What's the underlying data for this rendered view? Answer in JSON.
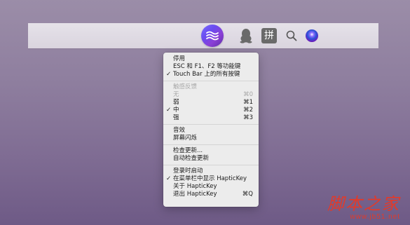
{
  "menubar": {
    "icons": [
      "haptickey-icon",
      "qq-penguin-icon",
      "pinyin-input-icon",
      "spotlight-search-icon",
      "siri-icon"
    ],
    "pinyin_label": "拼"
  },
  "menu": {
    "items": [
      {
        "label": "停用",
        "checked": false,
        "disabled": false,
        "shortcut": ""
      },
      {
        "label": "ESC 和 F1、F2 等功能键",
        "checked": false,
        "disabled": false,
        "shortcut": ""
      },
      {
        "label": "Touch Bar 上的所有按键",
        "checked": true,
        "disabled": false,
        "shortcut": ""
      },
      {
        "label": "触感反馈",
        "checked": false,
        "disabled": true,
        "shortcut": ""
      },
      {
        "label": "无",
        "checked": false,
        "disabled": true,
        "shortcut": "⌘0"
      },
      {
        "label": "弱",
        "checked": false,
        "disabled": false,
        "shortcut": "⌘1"
      },
      {
        "label": "中",
        "checked": true,
        "disabled": false,
        "shortcut": "⌘2"
      },
      {
        "label": "强",
        "checked": false,
        "disabled": false,
        "shortcut": "⌘3"
      },
      {
        "label": "音效",
        "checked": false,
        "disabled": false,
        "shortcut": ""
      },
      {
        "label": "屏幕闪烁",
        "checked": false,
        "disabled": false,
        "shortcut": ""
      },
      {
        "label": "检查更新...",
        "checked": false,
        "disabled": false,
        "shortcut": ""
      },
      {
        "label": "自动检查更新",
        "checked": false,
        "disabled": false,
        "shortcut": ""
      },
      {
        "label": "登录时启动",
        "checked": false,
        "disabled": false,
        "shortcut": ""
      },
      {
        "label": "在菜单栏中显示 HapticKey",
        "checked": true,
        "disabled": false,
        "shortcut": ""
      },
      {
        "label": "关于 HapticKey",
        "checked": false,
        "disabled": false,
        "shortcut": ""
      },
      {
        "label": "退出 HapticKey",
        "checked": false,
        "disabled": false,
        "shortcut": "⌘Q"
      }
    ],
    "check_mark": "✓"
  },
  "watermark": {
    "title": "脚本之家",
    "url": "www.jb51.net"
  },
  "colors": {
    "accent": "#7b5cf0",
    "watermark": "#e23a2a"
  }
}
